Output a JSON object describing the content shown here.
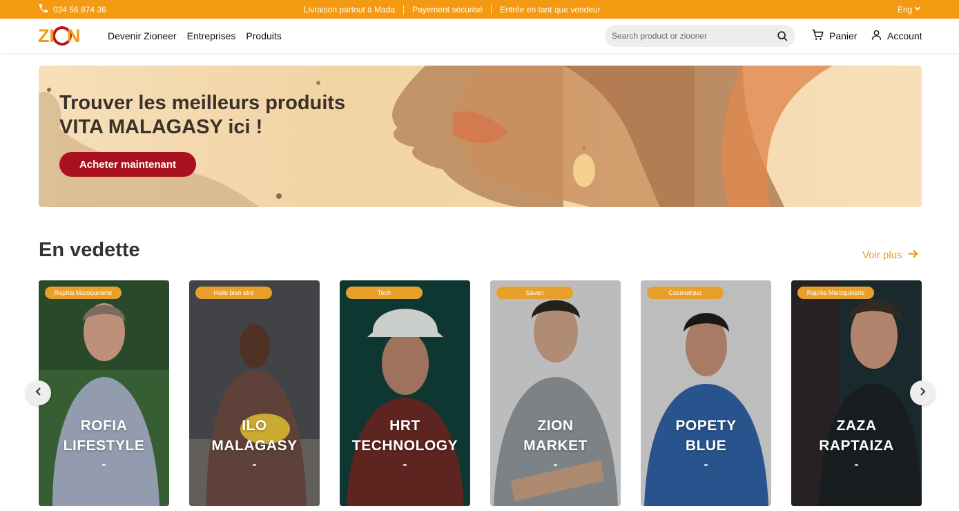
{
  "topbar": {
    "phone": "034 56 874 36",
    "links": [
      "Livraison partout à Mada",
      "Payement sécurisé",
      "Entrée en tant que vendeur"
    ],
    "language": "Eng"
  },
  "header": {
    "logo_text": "ZION",
    "nav": [
      "Devenir Zioneer",
      "Entreprises",
      "Produits"
    ],
    "search_placeholder": "Search product or ziooner",
    "cart_label": "Panier",
    "account_label": "Account"
  },
  "hero": {
    "title_line1": "Trouver les meilleurs produits",
    "title_line2": "VITA MALAGASY ici !",
    "cta": "Acheter maintenant"
  },
  "featured": {
    "title": "En vedette",
    "more": "Voir plus",
    "cards": [
      {
        "tag": "Raphia Maroquinerie",
        "line1": "ROFIA",
        "line2": "LIFESTYLE",
        "dash": "-"
      },
      {
        "tag": "Huile bien etre",
        "line1": "ILO",
        "line2": "MALAGASY",
        "dash": "-"
      },
      {
        "tag": "Tech",
        "line1": "HRT",
        "line2": "TECHNOLOGY",
        "dash": "-"
      },
      {
        "tag": "Savon",
        "line1": "ZION",
        "line2": "MARKET",
        "dash": "-"
      },
      {
        "tag": "Cosmetique",
        "line1": "POPETY",
        "line2": "BLUE",
        "dash": "-"
      },
      {
        "tag": "Raphia Maroquinerie",
        "line1": "ZAZA",
        "line2": "RAPTAIZA",
        "dash": "-"
      }
    ]
  },
  "colors": {
    "accent": "#f39a12",
    "cta": "#a8111d",
    "hero_bg": "#f6dfb9"
  }
}
